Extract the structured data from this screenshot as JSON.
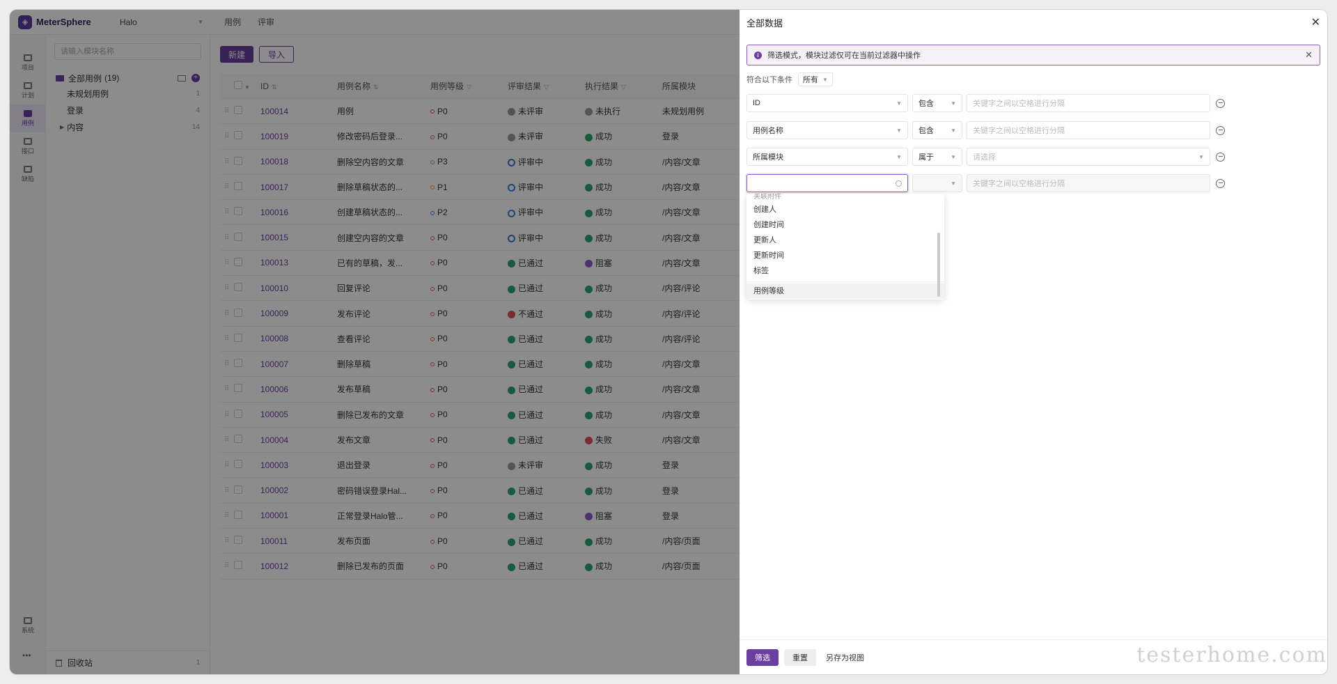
{
  "app": {
    "name": "MeterSphere",
    "project": "Halo"
  },
  "top_tabs": [
    "用例",
    "评审"
  ],
  "nav": [
    {
      "label": "项目",
      "icon": "project-icon"
    },
    {
      "label": "计划",
      "icon": "plan-icon"
    },
    {
      "label": "用例",
      "icon": "case-icon",
      "active": true
    },
    {
      "label": "接口",
      "icon": "api-icon"
    },
    {
      "label": "缺陷",
      "icon": "bug-icon"
    }
  ],
  "nav_bottom": {
    "label": "系统",
    "more": "•••"
  },
  "tree": {
    "search_placeholder": "请输入模块名称",
    "root_label": "全部用例",
    "root_count": "(19)",
    "nodes": [
      {
        "label": "未规划用例",
        "count": "1"
      },
      {
        "label": "登录",
        "count": "4"
      },
      {
        "label": "内容",
        "count": "14",
        "expandable": true
      }
    ],
    "recycle_label": "回收站",
    "recycle_count": "1"
  },
  "actions": {
    "create": "新建",
    "import": "导入"
  },
  "table": {
    "headers": {
      "id": "ID",
      "name": "用例名称",
      "level": "用例等级",
      "review": "评审结果",
      "exec": "执行结果",
      "module": "所属模块"
    },
    "rows": [
      {
        "id": "100014",
        "name": "用例",
        "level": "P0",
        "review": "未评审",
        "review_st": "grey",
        "exec": "未执行",
        "exec_st": "grey",
        "module": "未规划用例"
      },
      {
        "id": "100019",
        "name": "修改密码后登录...",
        "level": "P0",
        "review": "未评审",
        "review_st": "grey",
        "exec": "成功",
        "exec_st": "green",
        "module": "登录"
      },
      {
        "id": "100018",
        "name": "删除空内容的文章",
        "level": "P3",
        "review": "评审中",
        "review_st": "blue",
        "exec": "成功",
        "exec_st": "green",
        "module": "/内容/文章"
      },
      {
        "id": "100017",
        "name": "删除草稿状态的...",
        "level": "P1",
        "review": "评审中",
        "review_st": "blue",
        "exec": "成功",
        "exec_st": "green",
        "module": "/内容/文章"
      },
      {
        "id": "100016",
        "name": "创建草稿状态的...",
        "level": "P2",
        "review": "评审中",
        "review_st": "blue",
        "exec": "成功",
        "exec_st": "green",
        "module": "/内容/文章"
      },
      {
        "id": "100015",
        "name": "创建空内容的文章",
        "level": "P0",
        "review": "评审中",
        "review_st": "blue",
        "exec": "成功",
        "exec_st": "green",
        "module": "/内容/文章"
      },
      {
        "id": "100013",
        "name": "已有的草稿，发...",
        "level": "P0",
        "review": "已通过",
        "review_st": "green",
        "exec": "阻塞",
        "exec_st": "purple",
        "module": "/内容/文章"
      },
      {
        "id": "100010",
        "name": "回复评论",
        "level": "P0",
        "review": "已通过",
        "review_st": "green",
        "exec": "成功",
        "exec_st": "green",
        "module": "/内容/评论"
      },
      {
        "id": "100009",
        "name": "发布评论",
        "level": "P0",
        "review": "不通过",
        "review_st": "red",
        "exec": "成功",
        "exec_st": "green",
        "module": "/内容/评论"
      },
      {
        "id": "100008",
        "name": "查看评论",
        "level": "P0",
        "review": "已通过",
        "review_st": "green",
        "exec": "成功",
        "exec_st": "green",
        "module": "/内容/评论"
      },
      {
        "id": "100007",
        "name": "删除草稿",
        "level": "P0",
        "review": "已通过",
        "review_st": "green",
        "exec": "成功",
        "exec_st": "green",
        "module": "/内容/文章"
      },
      {
        "id": "100006",
        "name": "发布草稿",
        "level": "P0",
        "review": "已通过",
        "review_st": "green",
        "exec": "成功",
        "exec_st": "green",
        "module": "/内容/文章"
      },
      {
        "id": "100005",
        "name": "删除已发布的文章",
        "level": "P0",
        "review": "已通过",
        "review_st": "green",
        "exec": "成功",
        "exec_st": "green",
        "module": "/内容/文章"
      },
      {
        "id": "100004",
        "name": "发布文章",
        "level": "P0",
        "review": "已通过",
        "review_st": "green",
        "exec": "失败",
        "exec_st": "red",
        "module": "/内容/文章"
      },
      {
        "id": "100003",
        "name": "退出登录",
        "level": "P0",
        "review": "未评审",
        "review_st": "grey",
        "exec": "成功",
        "exec_st": "green",
        "module": "登录"
      },
      {
        "id": "100002",
        "name": "密码错误登录Hal...",
        "level": "P0",
        "review": "已通过",
        "review_st": "green",
        "exec": "成功",
        "exec_st": "green",
        "module": "登录"
      },
      {
        "id": "100001",
        "name": "正常登录Halo管...",
        "level": "P0",
        "review": "已通过",
        "review_st": "green",
        "exec": "阻塞",
        "exec_st": "purple",
        "module": "登录"
      },
      {
        "id": "100011",
        "name": "发布页面",
        "level": "P0",
        "review": "已通过",
        "review_st": "green",
        "exec": "成功",
        "exec_st": "green",
        "module": "/内容/页面"
      },
      {
        "id": "100012",
        "name": "删除已发布的页面",
        "level": "P0",
        "review": "已通过",
        "review_st": "green",
        "exec": "成功",
        "exec_st": "green",
        "module": "/内容/页面"
      }
    ]
  },
  "drawer": {
    "title": "全部数据",
    "alert": "筛选模式，模块过滤仅可在当前过滤器中操作",
    "cond_label": "符合以下条件",
    "cond_value": "所有",
    "filters": [
      {
        "field": "ID",
        "op": "包含",
        "value_placeholder": "关键字之间以空格进行分隔"
      },
      {
        "field": "用例名称",
        "op": "包含",
        "value_placeholder": "关键字之间以空格进行分隔"
      },
      {
        "field": "所属模块",
        "op": "属于",
        "value_placeholder": "请选择"
      },
      {
        "field": "",
        "op": "",
        "value_placeholder": "关键字之间以空格进行分隔"
      }
    ],
    "dropdown_partial": "关联附件",
    "dropdown_items": [
      "创建人",
      "创建时间",
      "更新人",
      "更新时间",
      "标签"
    ],
    "dropdown_hover": "用例等级",
    "footer": {
      "filter": "筛选",
      "reset": "重置",
      "save_view": "另存为视图"
    },
    "watermark": "testerhome.com"
  },
  "colors": {
    "brand": "#6b3fa0",
    "success": "#2ba471",
    "danger": "#e34d59"
  }
}
